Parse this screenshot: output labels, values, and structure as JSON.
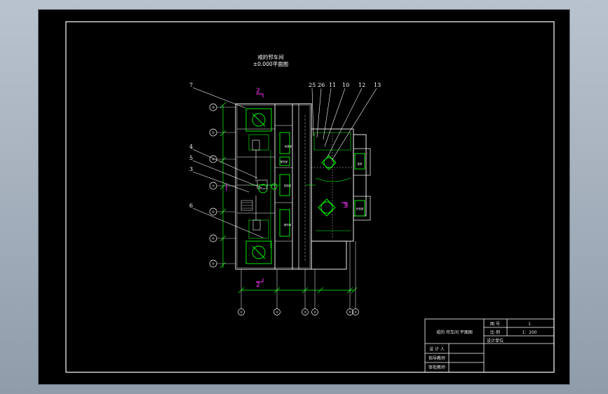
{
  "drawing": {
    "title_line1": "戒的邗车间",
    "title_line2": "±0.000平面图",
    "section_mark_top": "2",
    "section_mark_bottom": "2",
    "section_mark_side": "3",
    "callouts": [
      "7",
      "4",
      "5",
      "3",
      "6",
      "25",
      "26",
      "11",
      "10",
      "12",
      "13"
    ],
    "axis_labels_left": [
      "⑩",
      "⑨",
      "⑧",
      "⑦",
      "⑥",
      "⑤",
      "④"
    ],
    "axis_labels_bottom": [
      "①",
      "②",
      "③",
      "④",
      "⑤",
      "⑥"
    ],
    "room_labels": [
      "休息室",
      "配电室",
      "控制室",
      "操作间",
      "泵房",
      "化验室"
    ]
  },
  "title_block": {
    "drawing_name": "戒的 邗车间 平面图",
    "row1_label": "图  号",
    "row1_value": "1",
    "row2_label": "比  例",
    "row2_value": "1：200",
    "row3_label": "设计单位",
    "designer_label": "设 计 人",
    "checker_label": "指导教师",
    "reviewer_label": "审批教师"
  },
  "colors": {
    "line_white": "#ffffff",
    "line_green": "#00ff00",
    "line_magenta": "#ff33ff",
    "background": "#000000"
  }
}
